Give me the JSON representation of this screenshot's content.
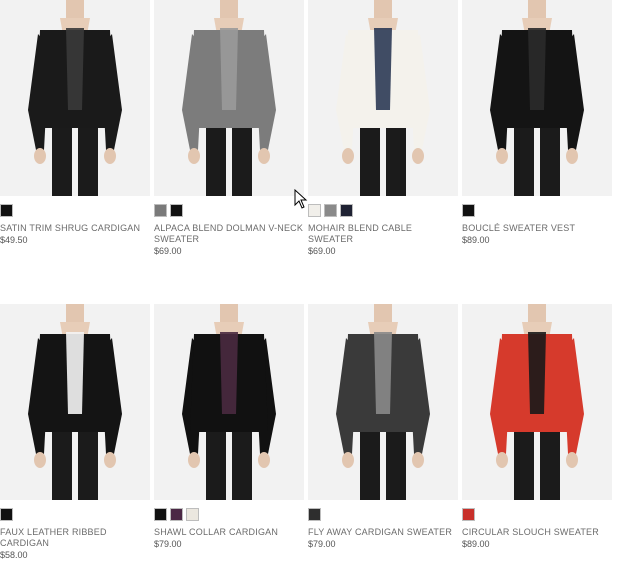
{
  "products": [
    {
      "name": "SATIN TRIM SHRUG CARDIGAN",
      "price": "$49.50",
      "garment_color": "#1a1a1a",
      "accent_color": "#3a3a3a",
      "swatches": [
        "#111111"
      ]
    },
    {
      "name": "ALPACA BLEND DOLMAN V-NECK SWEATER",
      "price": "$69.00",
      "garment_color": "#7c7c7c",
      "accent_color": "#9a9a9a",
      "swatches": [
        "#7a7a7a",
        "#111111"
      ]
    },
    {
      "name": "MOHAIR BLEND CABLE SWEATER",
      "price": "$69.00",
      "garment_color": "#f4f2ec",
      "accent_color": "#2c3a55",
      "swatches": [
        "#f1efea",
        "#8a8a8a",
        "#1f2233"
      ]
    },
    {
      "name": "BOUCLÉ SWEATER VEST",
      "price": "$89.00",
      "garment_color": "#141414",
      "accent_color": "#2a2a2a",
      "swatches": [
        "#111111"
      ]
    },
    {
      "name": "FAUX LEATHER RIBBED CARDIGAN",
      "price": "$58.00",
      "garment_color": "#141414",
      "accent_color": "#f4f4f4",
      "swatches": [
        "#111111"
      ]
    },
    {
      "name": "SHAWL COLLAR CARDIGAN",
      "price": "$79.00",
      "garment_color": "#111111",
      "accent_color": "#4a2a40",
      "swatches": [
        "#111111",
        "#4b2845",
        "#ebe7df"
      ]
    },
    {
      "name": "FLY AWAY CARDIGAN SWEATER",
      "price": "$79.00",
      "garment_color": "#3a3a3a",
      "accent_color": "#8a8a8a",
      "swatches": [
        "#2e2e2e"
      ]
    },
    {
      "name": "CIRCULAR SLOUCH SWEATER",
      "price": "$89.00",
      "garment_color": "#d63a2c",
      "accent_color": "#1a1a1a",
      "swatches": [
        "#c8302a"
      ]
    }
  ]
}
